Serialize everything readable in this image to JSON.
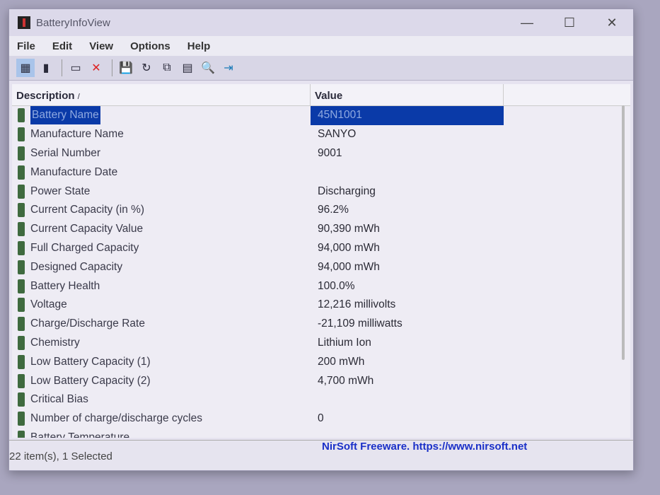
{
  "window": {
    "title": "BatteryInfoView",
    "controls": [
      "—",
      "☐",
      "✕"
    ]
  },
  "menu": [
    "File",
    "Edit",
    "View",
    "Options",
    "Help"
  ],
  "toolbar": [
    {
      "icon": "properties-icon",
      "glyph": "▦"
    },
    {
      "icon": "clipboard-icon",
      "glyph": "▮"
    },
    {
      "icon": "html-report-icon",
      "glyph": "▭"
    },
    {
      "icon": "delete-icon",
      "glyph": "✕"
    },
    {
      "icon": "save-icon",
      "glyph": "💾"
    },
    {
      "icon": "refresh-icon",
      "glyph": "↻"
    },
    {
      "icon": "copy-icon",
      "glyph": "⧉"
    },
    {
      "icon": "options-icon",
      "glyph": "▤"
    },
    {
      "icon": "find-icon",
      "glyph": "🔍"
    },
    {
      "icon": "exit-icon",
      "glyph": "⇥"
    }
  ],
  "columns": [
    "Description",
    "Value"
  ],
  "rows": [
    {
      "d": "Battery Name",
      "v": "45N1001",
      "sel": true
    },
    {
      "d": "Manufacture Name",
      "v": "SANYO"
    },
    {
      "d": "Serial Number",
      "v": "9001"
    },
    {
      "d": "Manufacture Date",
      "v": ""
    },
    {
      "d": "Power State",
      "v": "Discharging"
    },
    {
      "d": "Current Capacity (in %)",
      "v": "96.2%"
    },
    {
      "d": "Current Capacity Value",
      "v": "90,390 mWh"
    },
    {
      "d": "Full Charged Capacity",
      "v": "94,000 mWh"
    },
    {
      "d": "Designed Capacity",
      "v": "94,000 mWh"
    },
    {
      "d": "Battery Health",
      "v": "100.0%"
    },
    {
      "d": "Voltage",
      "v": "12,216 millivolts"
    },
    {
      "d": "Charge/Discharge Rate",
      "v": "-21,109 milliwatts"
    },
    {
      "d": "Chemistry",
      "v": "Lithium Ion"
    },
    {
      "d": "Low Battery Capacity (1)",
      "v": "200 mWh"
    },
    {
      "d": "Low Battery Capacity (2)",
      "v": "4,700 mWh"
    },
    {
      "d": "Critical Bias",
      "v": ""
    },
    {
      "d": "Number of charge/discharge cycles",
      "v": "0"
    },
    {
      "d": "Battery Temperature",
      "v": ""
    }
  ],
  "status": {
    "items": "22 item(s), 1 Selected",
    "credit": "NirSoft Freeware. https://www.nirsoft.net"
  }
}
